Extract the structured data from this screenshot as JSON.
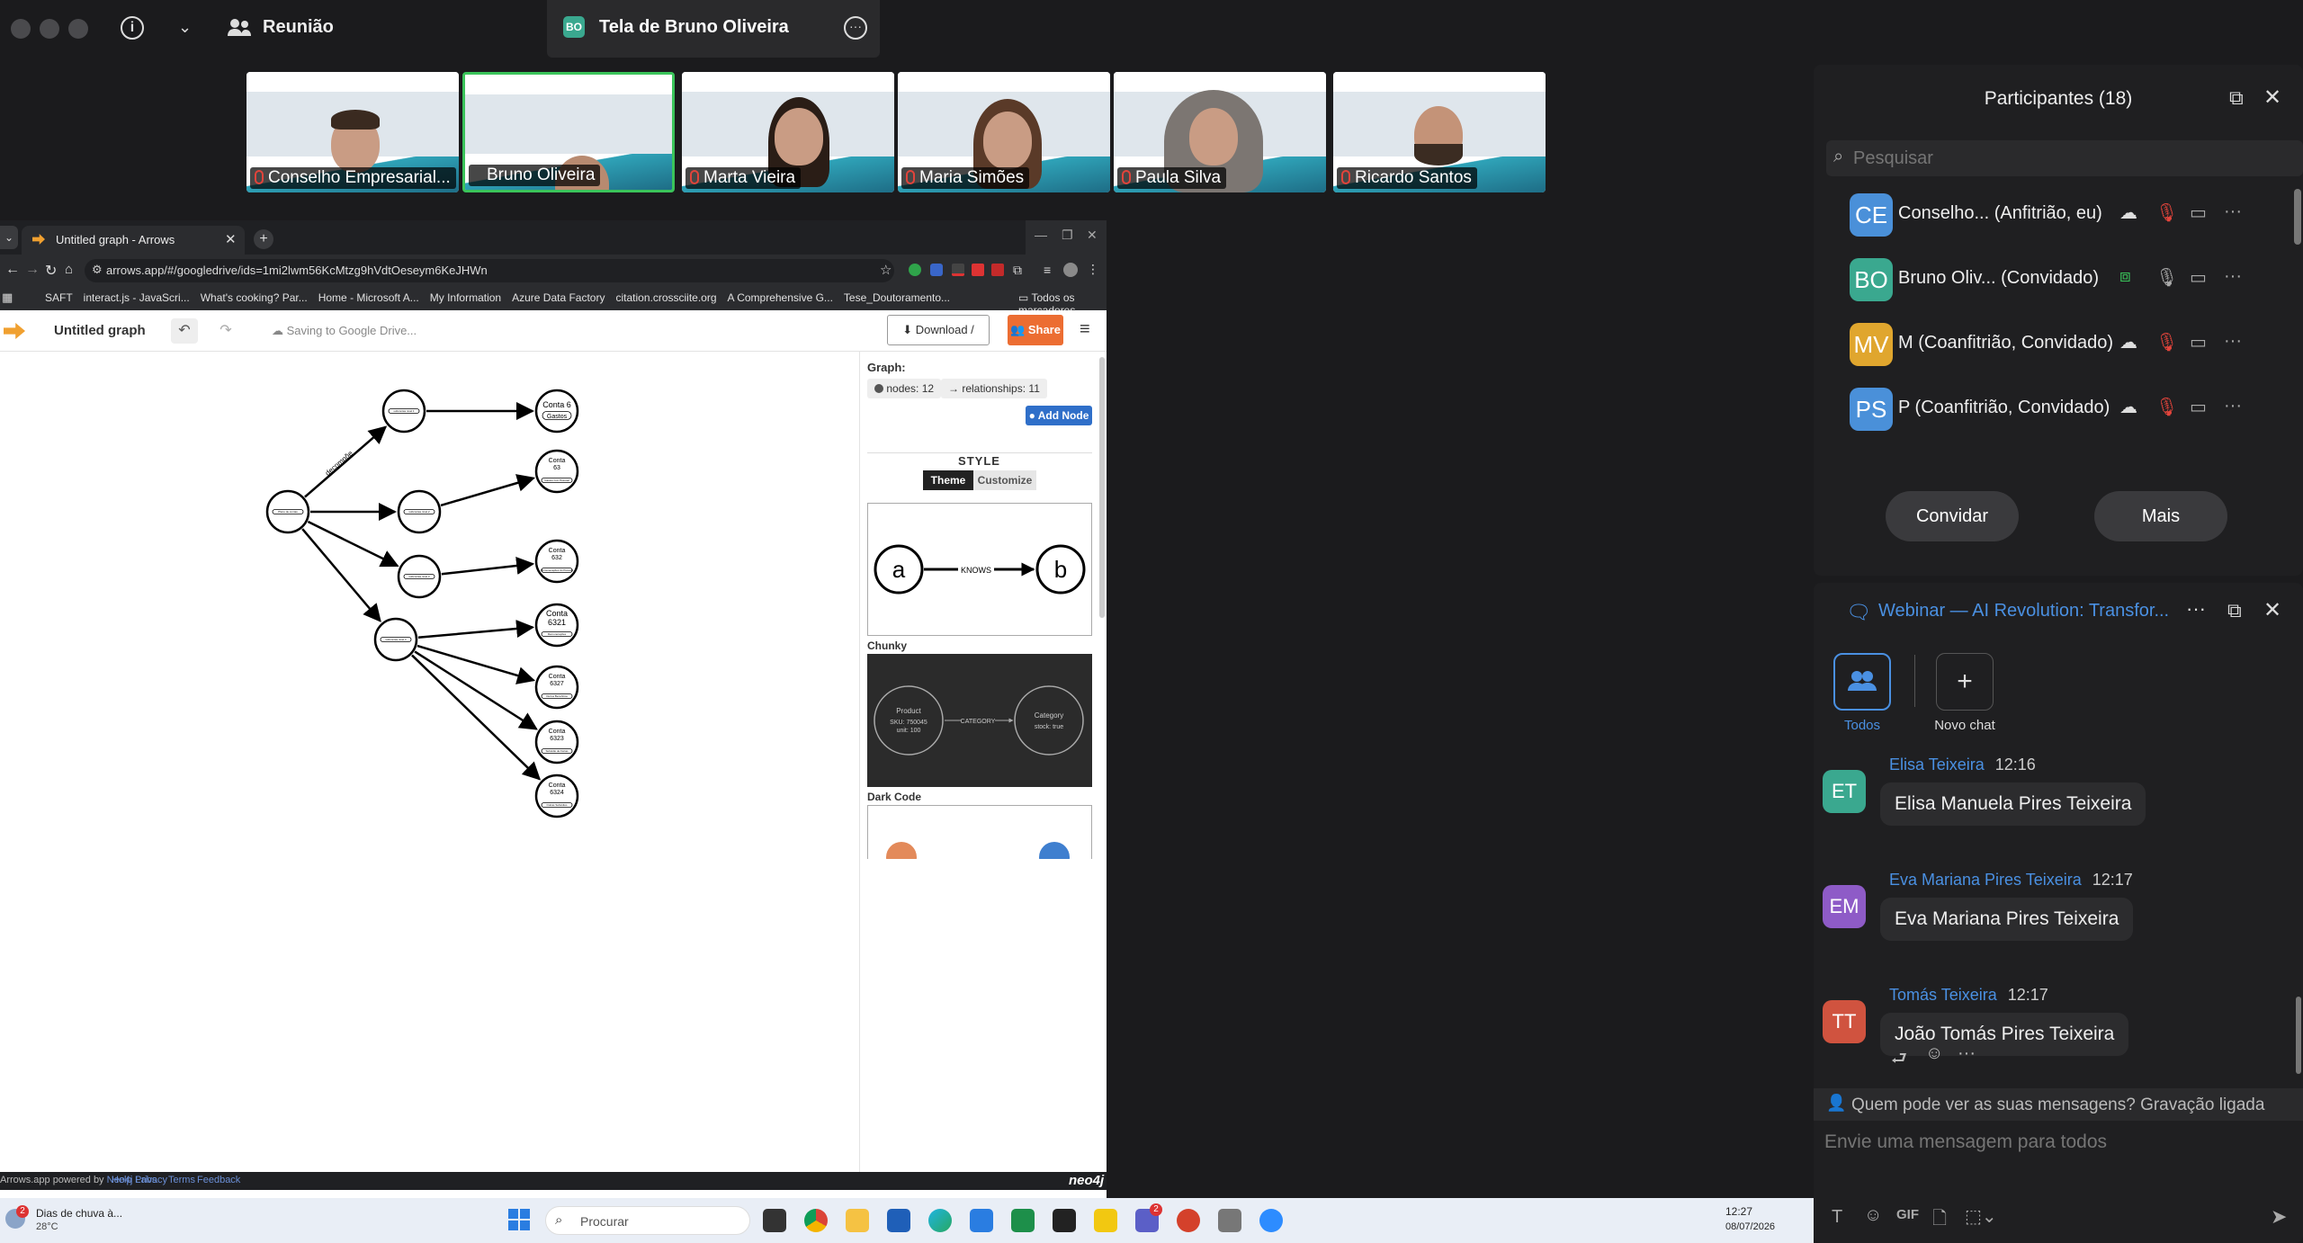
{
  "topbar": {
    "meeting_label": "Reunião",
    "share_badge": "BO",
    "share_title": "Tela de Bruno Oliveira"
  },
  "videos": [
    {
      "name": "Conselho Empresarial..."
    },
    {
      "name": "Bruno Oliveira"
    },
    {
      "name": "Marta Vieira"
    },
    {
      "name": "Maria Simões"
    },
    {
      "name": "Paula Silva"
    },
    {
      "name": "Ricardo Santos"
    }
  ],
  "browser": {
    "tab_title": "Untitled graph - Arrows",
    "url": "arrows.app/#/googledrive/ids=1mi2lwm56KcMtzg9hVdtOeseym6KeJHWn",
    "bookmarks": [
      "SAFT",
      "interact.js - JavaScri...",
      "What's cooking? Par...",
      "Home - Microsoft A...",
      "My Information",
      "Azure Data Factory",
      "citation.crossciite.org",
      "A Comprehensive G...",
      "Tese_Doutoramento..."
    ],
    "bookmarks_all": "Todos os marcadores"
  },
  "app": {
    "title": "Untitled graph",
    "saving": "Saving to Google Drive...",
    "download": "Download / Export",
    "share": "Share",
    "footer_brand": "Arrows.app powered by",
    "footer_brand_link": "Neo4j Labs",
    "footer_links": [
      "Help",
      "Privacy",
      "Terms",
      "Feedback"
    ],
    "neo4j": "neo4j"
  },
  "inspector": {
    "graph_label": "Graph:",
    "nodes_label": "nodes:",
    "nodes_count": "12",
    "relationships_label": "relationships:",
    "relationships_count": "11",
    "add_node": "Add Node",
    "style_heading": "STYLE",
    "theme_tab": "Theme",
    "customize_tab": "Customize",
    "themes": [
      {
        "name": "Chunky",
        "a": "a",
        "b": "b",
        "rel": "KNOWS"
      },
      {
        "name": "Dark Code",
        "left_title": "Product",
        "left_line1": "SKU: 750045",
        "left_line2": "unit: 100",
        "rel": "CATEGORY",
        "right_title": "Category",
        "right_line1": "stock: true"
      }
    ]
  },
  "graph": {
    "edge_label": "decompõe",
    "nodes": [
      {
        "id": "root",
        "caption": "",
        "prop": "Plano de contas"
      },
      {
        "id": "n1",
        "caption": "",
        "prop": "subcontas nivel 1"
      },
      {
        "id": "n2",
        "caption": "",
        "prop": "subcontas nivel 2"
      },
      {
        "id": "n3",
        "caption": "",
        "prop": "subcontas nivel 3"
      },
      {
        "id": "n4",
        "caption": "",
        "prop": "subcontas nivel 4"
      },
      {
        "id": "c6",
        "caption": "Conta 6",
        "prop": "Gastos"
      },
      {
        "id": "c63",
        "caption": "Conta\n63",
        "prop": "Gastos com Pessoal"
      },
      {
        "id": "c632",
        "caption": "Conta\n632",
        "prop": "Remunerações do Pessoal"
      },
      {
        "id": "c6321",
        "caption": "Conta\n6321",
        "prop": "Remunerações"
      },
      {
        "id": "c6327",
        "caption": "Conta\n6327",
        "prop": "Outros Benefícios"
      },
      {
        "id": "c6323",
        "caption": "Conta\n6323",
        "prop": "Subsídio de Férias"
      },
      {
        "id": "c6324",
        "caption": "Conta\n6324",
        "prop": "Outras Subsídios"
      }
    ]
  },
  "participants": {
    "title": "Participantes (18)",
    "search_placeholder": "Pesquisar",
    "list": [
      {
        "initials": "CE",
        "name": "Conselho...",
        "role": "(Anfitrião, eu)",
        "color": "#4a90d9"
      },
      {
        "initials": "BO",
        "name": "Bruno Oliv...",
        "role": "(Convidado)",
        "color": "#3aa88f"
      },
      {
        "initials": "MV",
        "name": "M",
        "role": "(Coanfitrião, Convidado)",
        "color": "#e0a62e"
      },
      {
        "initials": "PS",
        "name": "P",
        "role": "(Coanfitrião, Convidado)",
        "color": "#4a90d9"
      }
    ],
    "invite": "Convidar",
    "more": "Mais"
  },
  "chat": {
    "title": "Webinar — AI Revolution: Transfor...",
    "tab_all": "Todos",
    "tab_new": "Novo chat",
    "messages": [
      {
        "initials": "ET",
        "sender": "Elisa Teixeira",
        "time": "12:16",
        "text": "Elisa Manuela Pires Teixeira",
        "color": "#3aa88f"
      },
      {
        "initials": "EM",
        "sender": "Eva Mariana Pires Teixeira",
        "time": "12:17",
        "text": "Eva Mariana Pires Teixeira",
        "color": "#8e5bc7"
      },
      {
        "initials": "TT",
        "sender": "Tomás Teixeira",
        "time": "12:17",
        "text": "João Tomás Pires Teixeira",
        "color": "#d0533f"
      }
    ],
    "visibility": "Quem pode ver as suas mensagens? Gravação ligada",
    "input_placeholder": "Envie uma mensagem para todos",
    "gif": "GIF"
  },
  "taskbar": {
    "weather_title": "Dias de chuva à...",
    "weather_temp": "28°C",
    "weather_badge": "2",
    "search": "Procurar",
    "teams_badge": "2",
    "time": "12:27",
    "date": "08/07/2026"
  }
}
